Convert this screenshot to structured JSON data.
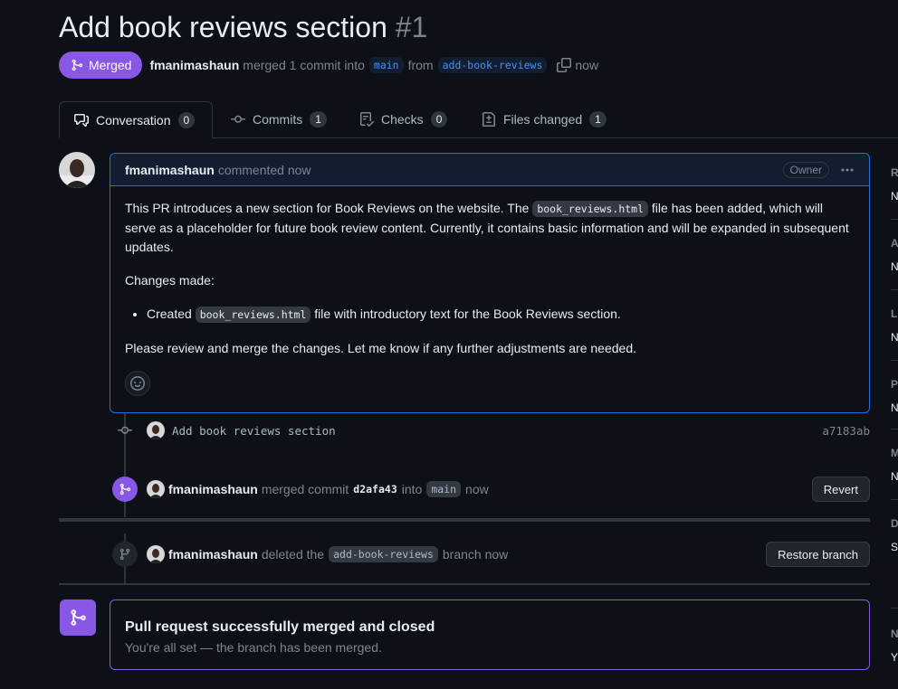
{
  "pr": {
    "title": "Add book reviews section",
    "number": "#1",
    "state": "Merged",
    "author": "fmanimashaun",
    "summary_pre": "merged 1 commit into",
    "base_branch": "main",
    "from_word": "from",
    "head_branch": "add-book-reviews",
    "time": "now"
  },
  "tabs": [
    {
      "label": "Conversation",
      "count": "0",
      "icon": "comment-discussion-icon"
    },
    {
      "label": "Commits",
      "count": "1",
      "icon": "git-commit-icon"
    },
    {
      "label": "Checks",
      "count": "0",
      "icon": "checklist-icon"
    },
    {
      "label": "Files changed",
      "count": "1",
      "icon": "file-diff-icon"
    }
  ],
  "comment": {
    "author": "fmanimashaun",
    "meta": "commented now",
    "badge": "Owner",
    "para1_a": "This PR introduces a new section for Book Reviews on the website. The",
    "para1_code": "book_reviews.html",
    "para1_b": "file has been added, which will serve as a placeholder for future book review content. Currently, it contains basic information and will be expanded in subsequent updates.",
    "changes_heading": "Changes made:",
    "bullet_a": "Created",
    "bullet_code": "book_reviews.html",
    "bullet_b": "file with introductory text for the Book Reviews section.",
    "closing": "Please review and merge the changes. Let me know if any further adjustments are needed."
  },
  "commit": {
    "message": "Add book reviews section",
    "sha": "a7183ab"
  },
  "merge_event": {
    "author": "fmanimashaun",
    "text1": "merged commit",
    "sha": "d2afa43",
    "text2": "into",
    "branch": "main",
    "time": "now",
    "button": "Revert"
  },
  "delete_event": {
    "author": "fmanimashaun",
    "text1": "deleted the",
    "branch": "add-book-reviews",
    "text2": "branch now",
    "button": "Restore branch"
  },
  "merge_status": {
    "heading": "Pull request successfully merged and closed",
    "subtext": "You're all set — the branch has been merged."
  },
  "sidebar": {
    "sections": [
      {
        "label": "R",
        "value": "N"
      },
      {
        "label": "A",
        "value": "N"
      },
      {
        "label": "L",
        "value": "N"
      },
      {
        "label": "P",
        "value": "N"
      },
      {
        "label": "M",
        "value": "N"
      },
      {
        "label": "D",
        "value": "S"
      },
      {
        "label": "N",
        "value": "Y"
      }
    ]
  },
  "colors": {
    "merged_purple": "#8957e5",
    "accent_blue": "#1f6feb",
    "background": "#0d1117"
  }
}
